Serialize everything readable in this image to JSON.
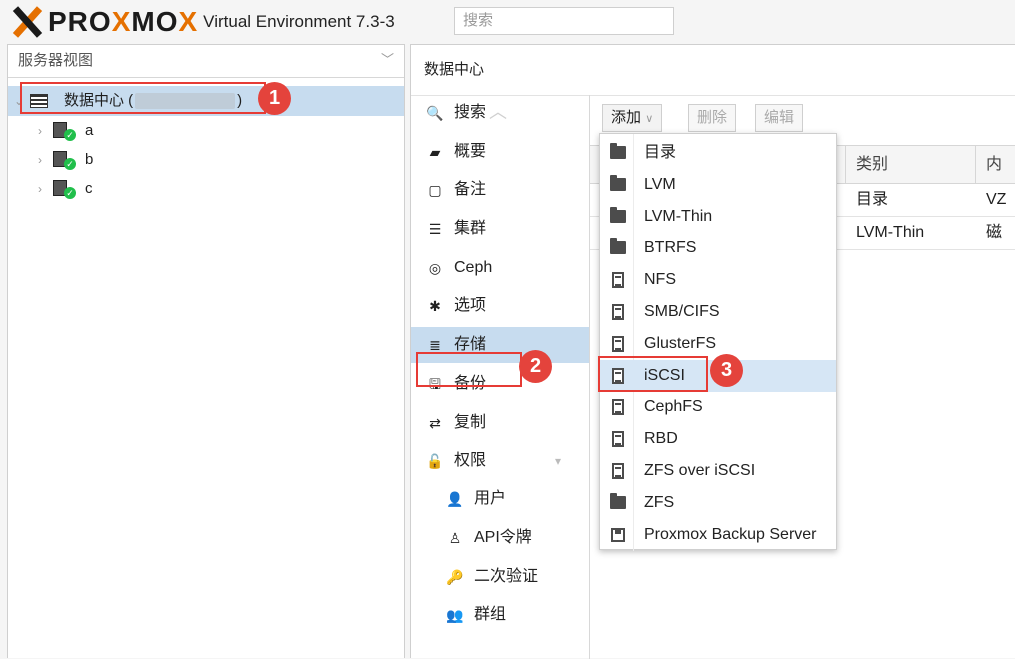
{
  "header": {
    "logo_pre": "PRO",
    "logo_x": "X",
    "logo_mid": "MO",
    "logo_end": "X",
    "product": "Virtual Environment 7.3-3",
    "search_placeholder": "搜索"
  },
  "tree": {
    "view_label": "服务器视图",
    "datacenter": {
      "prefix": "数据中心 (",
      "suffix": ")"
    },
    "nodes": [
      {
        "name": "a"
      },
      {
        "name": "b"
      },
      {
        "name": "c"
      }
    ]
  },
  "main": {
    "title": "数据中心",
    "menu": [
      {
        "label": "搜索",
        "icon": "search-icon",
        "glyph": "🔍"
      },
      {
        "label": "概要",
        "icon": "book-icon",
        "glyph": "▰"
      },
      {
        "label": "备注",
        "icon": "note-icon",
        "glyph": "▢"
      },
      {
        "label": "集群",
        "icon": "server-icon",
        "glyph": "☰"
      },
      {
        "label": "Ceph",
        "icon": "ceph-icon",
        "glyph": "◎"
      },
      {
        "label": "选项",
        "icon": "gear-icon",
        "glyph": "✱"
      },
      {
        "label": "存储",
        "icon": "database-icon",
        "glyph": "≣"
      },
      {
        "label": "备份",
        "icon": "floppy-icon",
        "glyph": "🖫"
      },
      {
        "label": "复制",
        "icon": "retweet-icon",
        "glyph": "⇄"
      },
      {
        "label": "权限",
        "icon": "unlock-icon",
        "glyph": "🔓"
      },
      {
        "label": "用户",
        "icon": "user-icon",
        "glyph": "👤"
      },
      {
        "label": "API令牌",
        "icon": "user-outline-icon",
        "glyph": "♙"
      },
      {
        "label": "二次验证",
        "icon": "key-icon",
        "glyph": "🔑"
      },
      {
        "label": "群组",
        "icon": "users-icon",
        "glyph": "👥"
      }
    ],
    "toolbar": {
      "add": "添加",
      "remove": "删除",
      "edit": "编辑"
    },
    "columns": [
      "类别",
      "内"
    ],
    "rows": [
      {
        "type": "目录",
        "content": "VZ"
      },
      {
        "type": "LVM-Thin",
        "content": "磁"
      }
    ]
  },
  "add_menu": {
    "items": [
      {
        "label": "目录",
        "icon": "folder"
      },
      {
        "label": "LVM",
        "icon": "folder"
      },
      {
        "label": "LVM-Thin",
        "icon": "folder"
      },
      {
        "label": "BTRFS",
        "icon": "folder"
      },
      {
        "label": "NFS",
        "icon": "disk"
      },
      {
        "label": "SMB/CIFS",
        "icon": "disk"
      },
      {
        "label": "GlusterFS",
        "icon": "disk"
      },
      {
        "label": "iSCSI",
        "icon": "disk"
      },
      {
        "label": "CephFS",
        "icon": "disk"
      },
      {
        "label": "RBD",
        "icon": "disk"
      },
      {
        "label": "ZFS over iSCSI",
        "icon": "disk"
      },
      {
        "label": "ZFS",
        "icon": "folder"
      },
      {
        "label": "Proxmox Backup Server",
        "icon": "floppy"
      }
    ],
    "highlighted": "iSCSI"
  },
  "callouts": [
    "1",
    "2",
    "3"
  ],
  "colors": {
    "brand": "#e57000",
    "selection": "#c7dcef",
    "callout": "#e4433c"
  }
}
